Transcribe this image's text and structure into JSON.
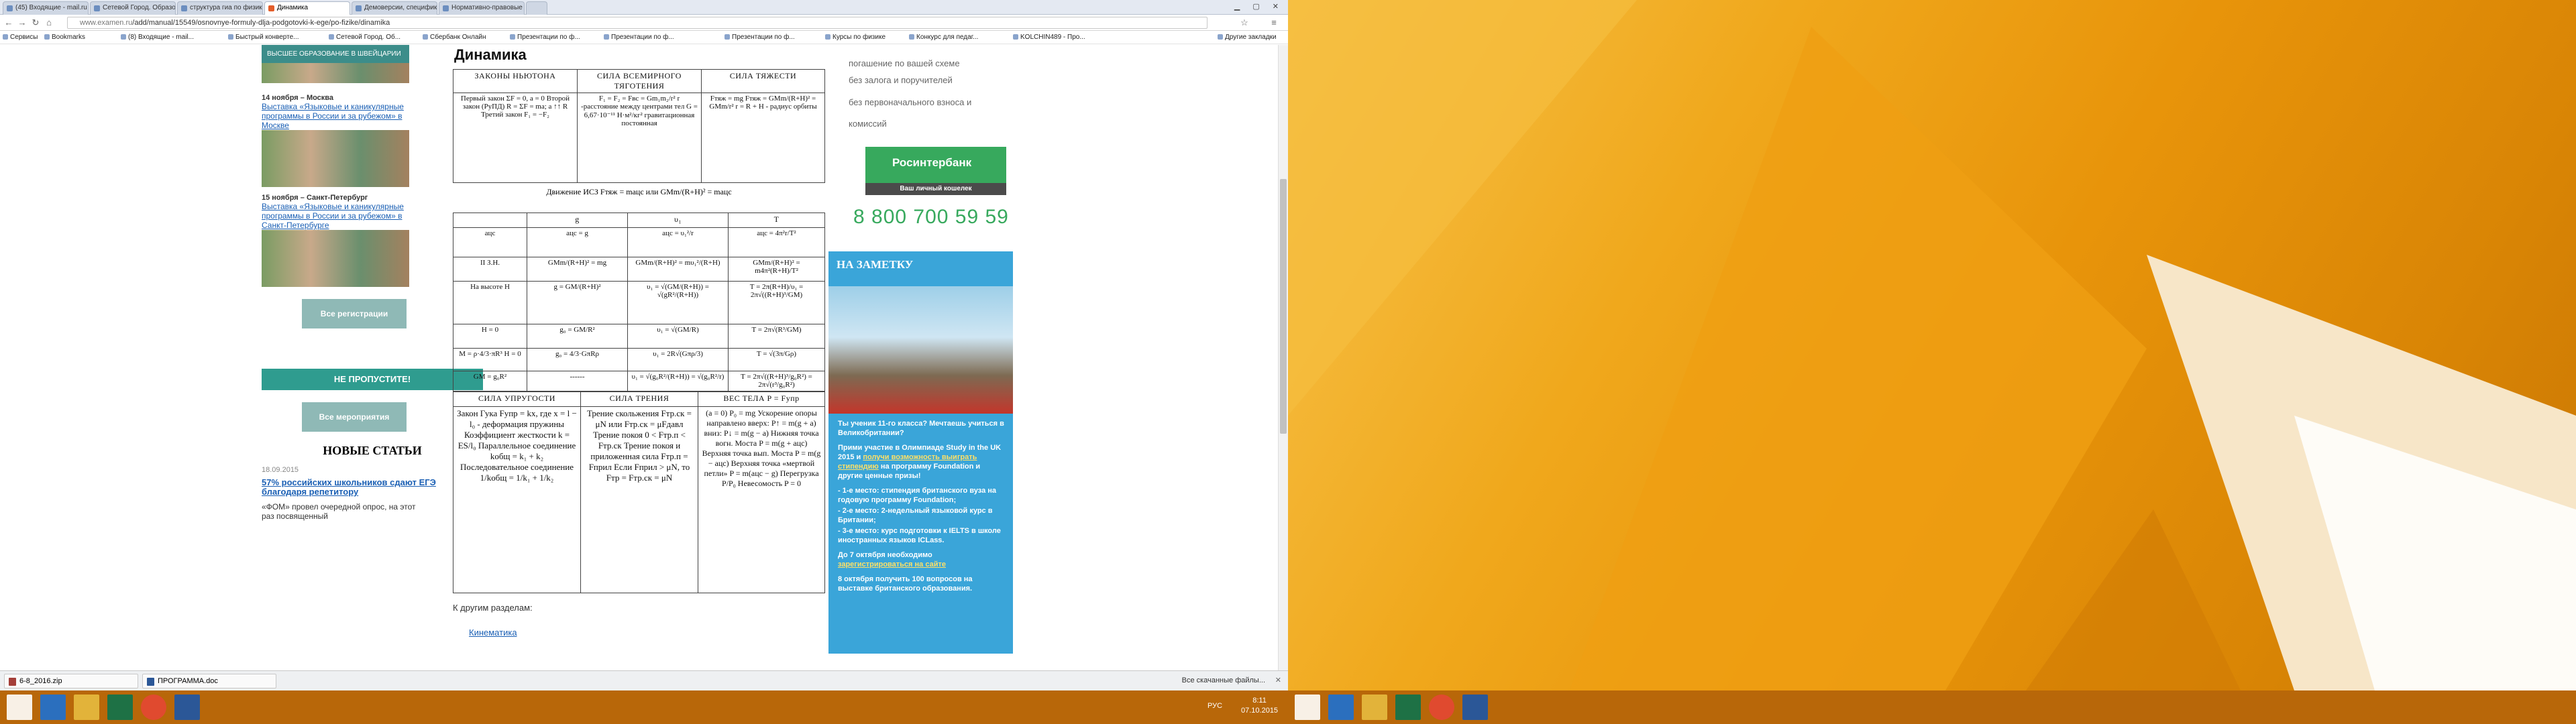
{
  "tabs": [
    {
      "label": "(45) Входящие - mail.ru"
    },
    {
      "label": "Сетевой Город. Образов"
    },
    {
      "label": "структура гиа по физик"
    },
    {
      "label": "Динамика",
      "active": true
    },
    {
      "label": "Демоверсии, специфик"
    },
    {
      "label": "Нормативно-правовые"
    }
  ],
  "omnibar": {
    "url_prefix": "www.examen.ru",
    "url_path": "/add/manual/15549/osnovnye-formuly-dlja-podgotovki-k-ege/po-fizike/dinamika"
  },
  "bookmarks": [
    "Сервисы",
    "Bookmarks",
    "(8) Входящие - mail...",
    "Быстрый конверте...",
    "Сетевой Город. Об...",
    "Сбербанк Онлайн",
    "Презентации по ф...",
    "Презентации по ф...",
    "Презентации по ф...",
    "Курсы по физике",
    "Конкурс для педаг...",
    "KOLCHIN489 - Про...",
    "Другие закладки"
  ],
  "left": {
    "promo_text": "ВЫСШЕЕ ОБРАЗОВАНИЕ В ШВЕЙЦАРИИ",
    "events": [
      {
        "date": "14 ноября – Москва",
        "link": "Выставка «Языковые и каникулярные программы в России и за рубежом» в Москве"
      },
      {
        "date": "15 ноября – Санкт-Петербург",
        "link": "Выставка «Языковые и каникулярные программы в России и за рубежом» в Санкт-Петербурге"
      }
    ],
    "all_reg": "Все регистрации",
    "dont_miss": "НЕ ПРОПУСТИТЕ!",
    "all_events": "Все мероприятия",
    "news_header": "НОВЫЕ СТАТЬИ",
    "news_date": "18.09.2015",
    "news_link": "57% российских школьников сдают ЕГЭ благодаря репетитору",
    "news_text": "«ФОМ» провел очередной опрос, на этот раз посвященный"
  },
  "main": {
    "title": "Динамика",
    "t1_headers": [
      "ЗАКОНЫ НЬЮТОНА",
      "СИЛА ВСЕМИРНОГО ТЯГОТЕНИЯ",
      "СИЛА ТЯЖЕСТИ"
    ],
    "t1_cells": [
      "Первый закон ΣF = 0, a = 0 Второй закон (РуПД) R = ΣF = ma; a ↑↑ R Третий закон F₁ = −F₂",
      "F₁ = F₂ = Fвс = Gm₁m₂/r²  r -расстояние между центрами тел  G = 6,67·10⁻¹¹ Н·м²/кг²  гравитационная постоянная",
      "Fтяж = mg  Fтяж = GMm/(R+H)² = GMm/r²  r = R + H - радиус орбиты"
    ],
    "between": "Движение ИСЗ   Fтяж = maцс   или   GMm/(R+H)² = maцс",
    "t2_headers": [
      "",
      "g",
      "υ₁",
      "T"
    ],
    "t2_rows": [
      [
        "aцс",
        "aцс = g",
        "aцс = υ₁²/r",
        "aцс = 4π²r/T²"
      ],
      [
        "II З.Н.",
        "GMm/(R+H)² = mg",
        "GMm/(R+H)² = mυ₁²/(R+H)",
        "GMm/(R+H)² = m4π²(R+H)/T²"
      ],
      [
        "На высоте H",
        "g = GM/(R+H)²",
        "υ₁ = √(GM/(R+H)) = √(gR²/(R+H))",
        "T = 2π(R+H)/υ₁ = 2π√((R+H)³/GM)"
      ],
      [
        "H = 0",
        "g₀ = GM/R²",
        "υ₁ = √(GM/R)",
        "T = 2π√(R³/GM)"
      ],
      [
        "M = ρ·4/3·πR³  H = 0",
        "g₀ = 4/3·GπRρ",
        "υ₁ = 2R√(Gπρ/3)",
        "T = √(3π/Gρ)"
      ],
      [
        "GM = g₀R²",
        "------",
        "υ₁ = √(g₀R²/(R+H)) = √(g₀R²/r)",
        "T = 2π√((R+H)³/g₀R²) = 2π√(r³/g₀R²)"
      ]
    ],
    "t3_headers": [
      "СИЛА УПРУГОСТИ",
      "СИЛА ТРЕНИЯ",
      "ВЕС ТЕЛА  P = Fупр"
    ],
    "t3_cells": [
      "Закон Гука  Fупр = kx,  где x = l − l₀  - деформация пружины  Коэффициент жесткости k = ES/l₀  Параллельное соединение kобщ = k₁ + k₂  Последовательное соединение 1/kобщ = 1/k₁ + 1/k₂",
      "Трение скольжения Fтр.ск = μN  или  Fтр.ск = μFдавл  Трение покоя 0 < Fтр.п < Fтр.ск  Трение покоя и приложенная сила  Fтр.п = Fприл  Если Fприл > μN, то  Fтр = Fтр.ск = μN",
      "(a = 0) P₀ = mg  Ускорение опоры направлено  вверх: P↑ = m(g + a)  вниз: P↓ = m(g − a)  Нижняя точка вогн. Моста  P = m(g + aцс)  Верхняя точка вып. Моста  P = m(g − aцс)  Верхняя точка «мертвой петли»  P = m(aцс − g)  Перегрузка P/P₀  Невесомость P = 0"
    ],
    "other": "К другим разделам:",
    "other_link": "Кинематика"
  },
  "right": {
    "items": [
      "погашение по вашей схеме",
      "без залога и поручителей",
      "без первоначального взноса и комиссий"
    ],
    "bank_name": "Росинтербанк",
    "bank_sub": "Ваш личный кошелек",
    "phone": "8 800 700 59 59",
    "note_title": "НА ЗАМЕТКУ",
    "note_q": "Ты ученик 11-го класса? Мечтаешь учиться в Великобритании?",
    "note_p1a": "Прими участие в Олимпиаде Study in the UK 2015 и",
    "note_p1b": "получи возможность выиграть стипендию",
    "note_p1c": "на программу Foundation и другие ценные призы!",
    "note_l1": "- 1-е место: стипендия британского вуза на годовую программу Foundation;",
    "note_l2": "- 2-е место: 2-недельный языковой курс в Британии;",
    "note_l3": "- 3-е место: курс подготовки к IELTS в школе иностранных языков ICLass.",
    "note_p2a": "До 7 октября необходимо",
    "note_p2b": "зарегистрироваться на сайте",
    "note_p3": "8 октября получить 100 вопросов на выставке британского образования."
  },
  "downloads": [
    {
      "name": "6-8_2016.zip",
      "type": "zip"
    },
    {
      "name": "ПРОГРАММА.doc",
      "type": "doc"
    }
  ],
  "all_downloads": "Все скачанные файлы...",
  "tray": {
    "lang": "РУС",
    "time": "8:11",
    "date": "07.10.2015"
  }
}
